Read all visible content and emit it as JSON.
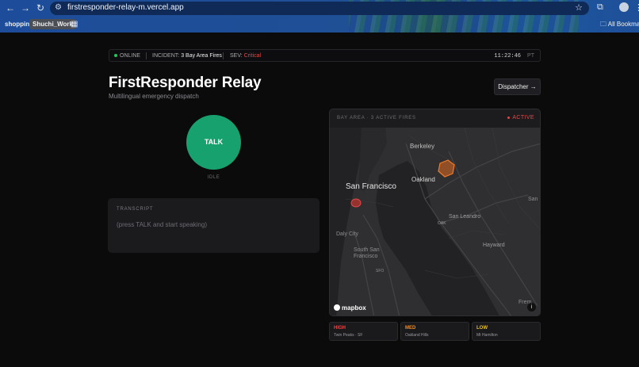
{
  "browser": {
    "url": "firstresponder-relay-m.vercel.app",
    "bookmarks": [
      "shoppin",
      "Shuchi_Work"
    ],
    "all_bookmarks": "All Bookmarks"
  },
  "status_bar": {
    "online": "ONLINE",
    "incident_label": "INCIDENT:",
    "incident_value": "3 Bay Area Fires",
    "sev_label": "SEV:",
    "sev_value": "Critical",
    "clock": "11:22:46",
    "timezone": "PT"
  },
  "header": {
    "title": "FirstResponder Relay",
    "subtitle": "Multilingual emergency dispatch",
    "dispatcher_button": "Dispatcher →"
  },
  "talk": {
    "label": "TALK",
    "state": "IDLE"
  },
  "transcript": {
    "label": "TRANSCRIPT",
    "placeholder": "(press TALK and start speaking)"
  },
  "map": {
    "header_label": "BAY AREA · 3 ACTIVE FIRES",
    "active_label": "ACTIVE",
    "attribution": "mapbox",
    "places": {
      "berkeley": "Berkeley",
      "san_francisco": "San Francisco",
      "oakland": "Oakland",
      "san_leandro": "San Leandro",
      "oak": "OAK",
      "daly_city": "Daly City",
      "south_sf_1": "South San",
      "south_sf_2": "Francisco",
      "sfo": "SFO",
      "hayward": "Hayward",
      "san_r": "San",
      "fremont": "Frem"
    },
    "colors": {
      "high": "#d9352e",
      "med": "#e06a1f"
    }
  },
  "legend": [
    {
      "level": "HIGH",
      "place": "Twin Peaks · SF",
      "color": "#e04848"
    },
    {
      "level": "MED",
      "place": "Oakland Hills",
      "color": "#f08a24"
    },
    {
      "level": "LOW",
      "place": "Mt Hamilton",
      "color": "#e8c020"
    }
  ]
}
